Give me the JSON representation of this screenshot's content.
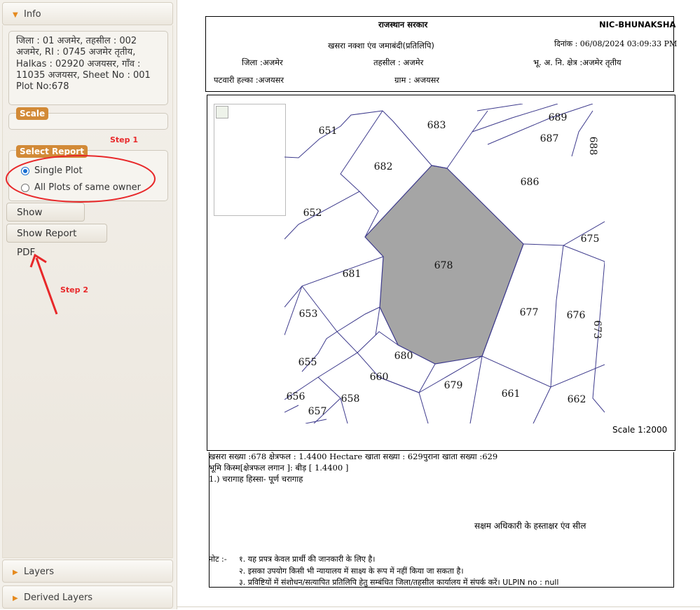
{
  "sidebar": {
    "info": {
      "title": "Info",
      "location_lines": [
        "जिला : 01 अजमेर, तहसील : 002",
        "अजमेर, RI : 0745 अजमेर तृतीय,",
        "Halkas : 02920 अजयसर, गाँव :",
        "11035 अजयसर, Sheet No : 001",
        "Plot No:678"
      ],
      "scale_legend": "Scale",
      "scale_value": "",
      "select_report_legend": "Select Report",
      "options": [
        "Single Plot",
        "All Plots of same owner"
      ],
      "selected_option": "Single Plot",
      "buttons": {
        "show_report": "Show Report",
        "show_report_pdf": "Show Report PDF"
      }
    },
    "layers_title": "Layers",
    "derived_layers_title": "Derived Layers"
  },
  "annotations": {
    "step1": "Step 1",
    "step2": "Step 2",
    "color": "#e8282a"
  },
  "report": {
    "govt": "राजस्थान सरकार",
    "org": "NIC-BHUNAKSHA",
    "doc_title": "खसरा नक्शा एंव जमाबंदी(प्रतिलिपि)",
    "date": "दिनांक : 06/08/2024 03:09:33 PM",
    "district": "जिला :अजमेर",
    "tehsil": "तहसील : अजमेर",
    "ri": "भू. अ. नि.  क्षेत्र :अजमेर तृतीय",
    "patwari": "पटवारी हल्का :अजयसर",
    "village": "ग्राम : अजयसर",
    "scale_label": "Scale 1:2000",
    "plots": [
      "651",
      "683",
      "689",
      "687",
      "688",
      "682",
      "686",
      "652",
      "675",
      "681",
      "678",
      "653",
      "677",
      "676",
      "673",
      "680",
      "655",
      "660",
      "679",
      "661",
      "656",
      "658",
      "662",
      "657"
    ],
    "highlight_plot": "678",
    "highlight_color": "#a5a5a5",
    "line_color": "#3d3a8c",
    "khasra_line": "खसरा सख्या :678 क्षेत्रफल  : 1.4400 Hectare  खाता सख्या   : 629पुराना खाता सख्या   :629",
    "land_type": "भूमि किस्म[क्षेत्रफल लगान ]: बीड़ [ 1.4400 ]",
    "owner_line": "1.) चरागाह   हिस्सा- पूर्ण    चरागाह",
    "signature": "सक्षम अधिकारी के हस्ताक्षर एंव सील",
    "note_label": "नोट :-",
    "notes": [
      "१. यह प्रपत्र केवल प्रार्थी की जानकारी के लिए है।",
      "२. इसका उपयोग किसी भी न्यायालय में साक्ष्य के रूप में नहीं किया जा सकता है।",
      "३. प्रविष्टियों में संशोधन/सत्यापित प्रतिलिपि  हेतु सम्बंधित जिला/तहसील कार्यालय में संपर्क करें।  ULPIN no : null"
    ]
  }
}
